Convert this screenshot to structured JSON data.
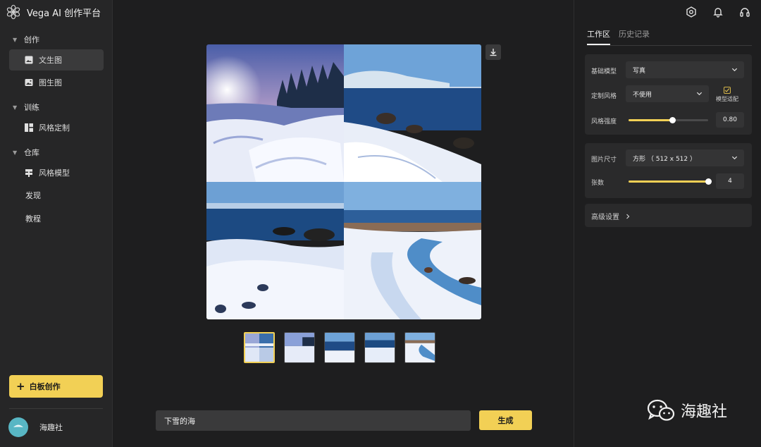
{
  "app": {
    "title": "Vega AI 创作平台"
  },
  "sidebar": {
    "sections": [
      {
        "label": "创作",
        "items": [
          "文生图",
          "图生图"
        ]
      },
      {
        "label": "训练",
        "items": [
          "风格定制"
        ]
      },
      {
        "label": "仓库",
        "items": [
          "风格模型"
        ]
      }
    ],
    "plain_items": [
      "发现",
      "教程"
    ],
    "whiteboard_button": "白板创作",
    "user": {
      "name": "海趣社"
    }
  },
  "header_icons": [
    "settings-hex-icon",
    "bell-icon",
    "headset-icon"
  ],
  "main": {
    "thumbnail_count": 5,
    "selected_thumbnail": 1,
    "prompt_value": "下雪的海",
    "generate_label": "生成"
  },
  "panel": {
    "tabs": [
      "工作区",
      "历史记录"
    ],
    "active_tab": "工作区",
    "base_model": {
      "label": "基础模型",
      "value": "写真"
    },
    "custom_style": {
      "label": "定制风格",
      "value": "不使用",
      "fit_label": "模型适配"
    },
    "style_strength": {
      "label": "风格强度",
      "value": "0.80",
      "fraction": 0.55
    },
    "image_size": {
      "label": "图片尺寸",
      "value": "方形 （ 512 x 512 ）"
    },
    "count": {
      "label": "张数",
      "value": "4",
      "fraction": 1.0
    },
    "advanced": {
      "label": "高级设置"
    }
  },
  "watermark": {
    "text": "海趣社"
  },
  "colors": {
    "accent": "#f2d055",
    "background": "#1e1e1f",
    "panel": "#2a2a2b"
  }
}
